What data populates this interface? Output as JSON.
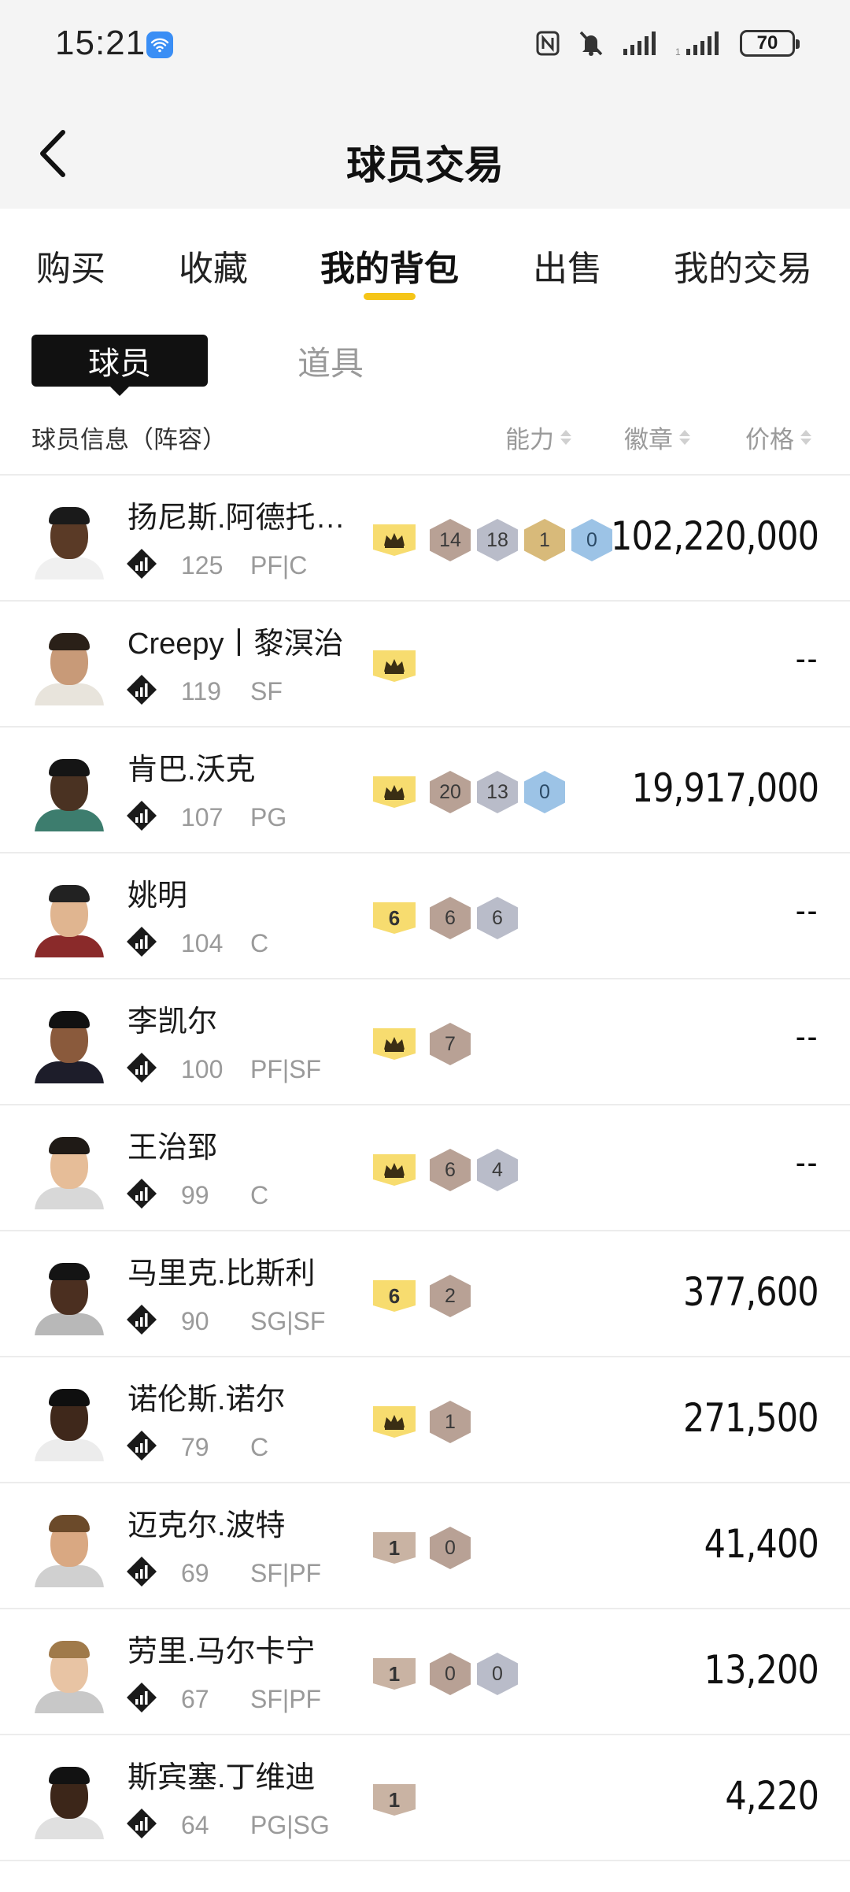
{
  "status": {
    "time": "15:21",
    "battery": "70"
  },
  "header": {
    "title": "球员交易"
  },
  "tabs": [
    "购买",
    "收藏",
    "我的背包",
    "出售",
    "我的交易"
  ],
  "active_tab": "我的背包",
  "subtabs": {
    "active": "球员",
    "other": "道具"
  },
  "columns": {
    "info": "球员信息（阵容）",
    "ability": "能力",
    "badge": "徽章",
    "price": "价格"
  },
  "colors": {
    "accent": "#f5c518",
    "crown": "#f7dc6f"
  },
  "players": [
    {
      "name": "扬尼斯.阿德托昆博",
      "ovr": "125",
      "pos": "PF|C",
      "ability": "crown",
      "badges": [
        {
          "v": "14",
          "t": "bronze"
        },
        {
          "v": "18",
          "t": "silver"
        },
        {
          "v": "1",
          "t": "gold"
        },
        {
          "v": "0",
          "t": "blue"
        }
      ],
      "price": "102,220,000"
    },
    {
      "name": "Creepy丨黎溟治",
      "ovr": "119",
      "pos": "SF",
      "ability": "crown",
      "badges": [],
      "price": "--"
    },
    {
      "name": "肯巴.沃克",
      "ovr": "107",
      "pos": "PG",
      "ability": "crown",
      "badges": [
        {
          "v": "20",
          "t": "bronze"
        },
        {
          "v": "13",
          "t": "silver"
        },
        {
          "v": "0",
          "t": "blue"
        }
      ],
      "price": "19,917,000"
    },
    {
      "name": "姚明",
      "ovr": "104",
      "pos": "C",
      "ability": "6",
      "badges": [
        {
          "v": "6",
          "t": "bronze"
        },
        {
          "v": "6",
          "t": "silver"
        }
      ],
      "price": "--"
    },
    {
      "name": "李凯尔",
      "ovr": "100",
      "pos": "PF|SF",
      "ability": "crown",
      "badges": [
        {
          "v": "7",
          "t": "bronze"
        }
      ],
      "price": "--"
    },
    {
      "name": "王治郅",
      "ovr": "99",
      "pos": "C",
      "ability": "crown",
      "badges": [
        {
          "v": "6",
          "t": "bronze"
        },
        {
          "v": "4",
          "t": "silver"
        }
      ],
      "price": "--"
    },
    {
      "name": "马里克.比斯利",
      "ovr": "90",
      "pos": "SG|SF",
      "ability": "6",
      "badges": [
        {
          "v": "2",
          "t": "bronze"
        }
      ],
      "price": "377,600"
    },
    {
      "name": "诺伦斯.诺尔",
      "ovr": "79",
      "pos": "C",
      "ability": "crown",
      "badges": [
        {
          "v": "1",
          "t": "bronze"
        }
      ],
      "price": "271,500"
    },
    {
      "name": "迈克尔.波特",
      "ovr": "69",
      "pos": "SF|PF",
      "ability": "1",
      "badges": [
        {
          "v": "0",
          "t": "bronze"
        }
      ],
      "price": "41,400"
    },
    {
      "name": "劳里.马尔卡宁",
      "ovr": "67",
      "pos": "SF|PF",
      "ability": "1",
      "badges": [
        {
          "v": "0",
          "t": "bronze"
        },
        {
          "v": "0",
          "t": "silver"
        }
      ],
      "price": "13,200"
    },
    {
      "name": "斯宾塞.丁维迪",
      "ovr": "64",
      "pos": "PG|SG",
      "ability": "1",
      "badges": [],
      "price": "4,220"
    }
  ]
}
